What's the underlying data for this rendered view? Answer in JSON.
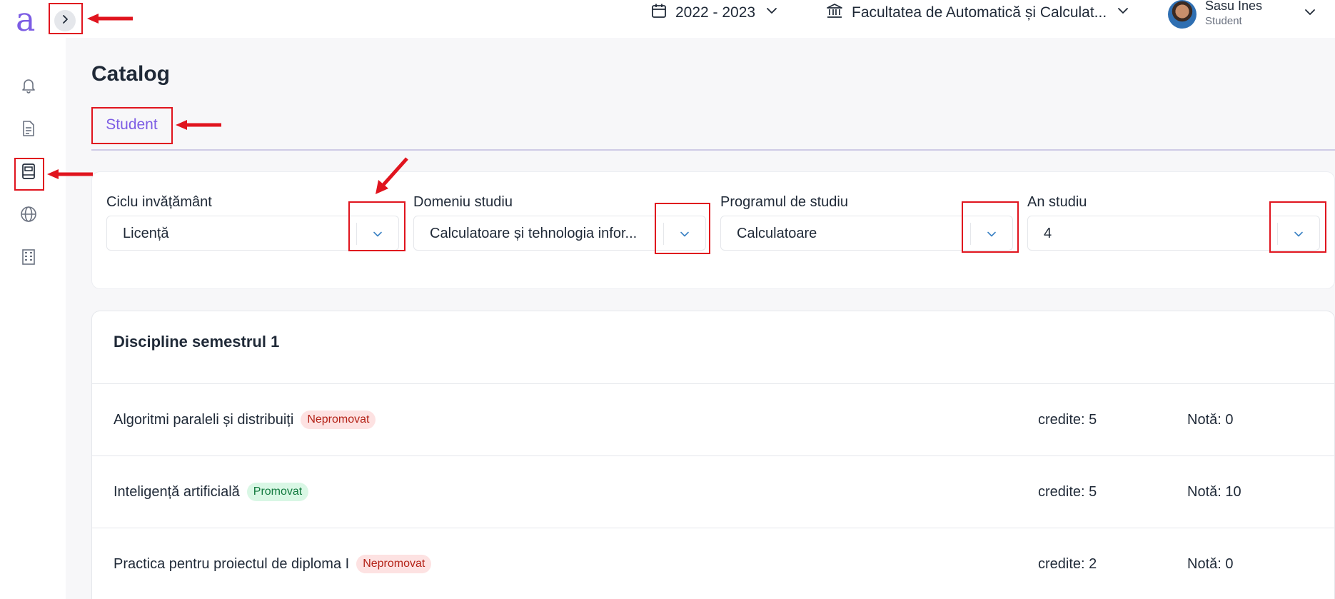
{
  "header": {
    "logo": "a",
    "year": "2022 - 2023",
    "faculty": "Facultatea de Automatică și Calculat...",
    "user": {
      "name": "Sasu Ines",
      "role": "Student"
    }
  },
  "sidebar": {
    "items": [
      {
        "icon": "bell-icon"
      },
      {
        "icon": "document-icon"
      },
      {
        "icon": "notebook-icon",
        "active": true
      },
      {
        "icon": "globe-icon"
      },
      {
        "icon": "building-icon"
      }
    ]
  },
  "page": {
    "title": "Catalog",
    "tabs": [
      {
        "label": "Student"
      }
    ]
  },
  "filters": [
    {
      "label": "Ciclu invățământ",
      "value": "Licență"
    },
    {
      "label": "Domeniu studiu",
      "value": "Calculatoare și tehnologia infor..."
    },
    {
      "label": "Programul de studiu",
      "value": "Calculatoare"
    },
    {
      "label": "An studiu",
      "value": "4"
    }
  ],
  "semester": {
    "title": "Discipline semestrul 1",
    "rows": [
      {
        "name": "Algoritmi paraleli și distribuiți",
        "status": "Nepromovat",
        "credits": "credite: 5",
        "grade": "Notă: 0"
      },
      {
        "name": "Inteligență artificială",
        "status": "Promovat",
        "credits": "credite: 5",
        "grade": "Notă: 10"
      },
      {
        "name": "Practica pentru proiectul de diploma I",
        "status": "Nepromovat",
        "credits": "credite: 2",
        "grade": "Notă: 0"
      }
    ]
  },
  "colors": {
    "accent": "#7c5ce4",
    "annotation": "#e0141e",
    "fail_bg": "#fde2e2",
    "pass_bg": "#d9f7e5"
  }
}
